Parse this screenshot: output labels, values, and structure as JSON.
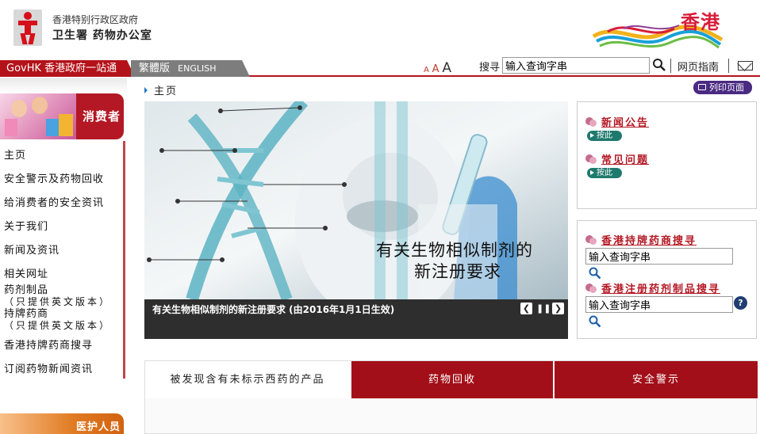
{
  "header": {
    "org_line1": "香港特别行政区政府",
    "org_line2": "卫生署  药物办公室",
    "brand": "香港"
  },
  "navbar": {
    "govhk": "GovHK 香港政府一站通",
    "lang_tc": "繁體版",
    "lang_en": "ENGLISH",
    "font_small": "A",
    "font_medium": "A",
    "font_large": "A",
    "search_label": "搜寻",
    "search_value": "输入查询字串",
    "sitemap": "网页指南"
  },
  "sidebar": {
    "consumer_title": "消费者",
    "items": [
      {
        "label": "主页"
      },
      {
        "label": "安全警示及药物回收"
      },
      {
        "label": "给消费者的安全资讯"
      },
      {
        "label": "关于我们"
      },
      {
        "label": "新闻及资讯"
      },
      {
        "label": "相关网址"
      },
      {
        "label": "药剂制品",
        "sub": "（只提供英文版本）"
      },
      {
        "label": "持牌药商",
        "sub": "（只提供英文版本）"
      },
      {
        "label": "香港持牌药商搜寻"
      },
      {
        "label": "订阅药物新闻资讯"
      }
    ],
    "pro_title": "医护人员"
  },
  "breadcrumb": "主页",
  "print_label": "列印页面",
  "hero": {
    "overlay_line1": "有关生物相似制剂的",
    "overlay_line2": "新注册要求",
    "caption": "有关生物相似制剂的新注册要求 (由2016年1月1日生效)",
    "prev": "❮",
    "pause": "❚❚",
    "next": "❯"
  },
  "panel1": {
    "news_title": "新闻公告",
    "news_btn": "按此",
    "faq_title": "常见问题",
    "faq_btn": "按此"
  },
  "panel2": {
    "trader_title": "香港持牌药商搜寻",
    "trader_value": "输入查询字串",
    "product_title": "香港注册药剂制品搜寻",
    "product_value": "输入查询字串",
    "help": "?"
  },
  "tabs": [
    {
      "label": "被发现含有未标示西药的产品"
    },
    {
      "label": "药物回收"
    },
    {
      "label": "安全警示"
    }
  ]
}
